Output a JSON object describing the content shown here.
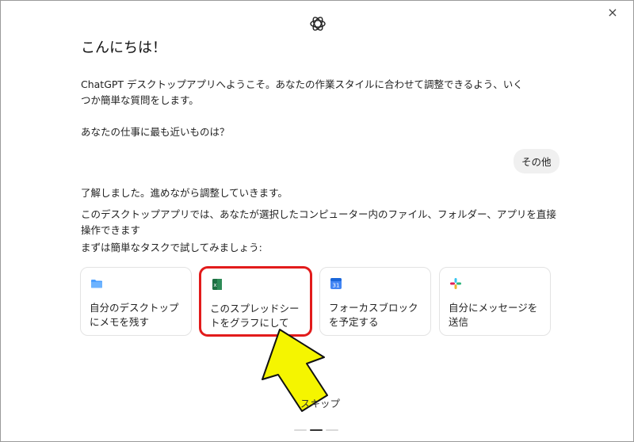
{
  "window": {
    "close_label": "×"
  },
  "greeting": "こんにちは！",
  "intro": "ChatGPT デスクトップアプリへようこそ。あなたの作業スタイルに合わせて調整できるよう、いくつか簡単な質問をします。",
  "question": "あなたの仕事に最も近いものは？",
  "user_reply": "その他",
  "ack": "了解しました。進めながら調整していきます。",
  "explain": "このデスクトップアプリでは、あなたが選択したコンピューター内のファイル、フォルダー、アプリを直接操作できます",
  "task_prompt": "まずは簡単なタスクで試してみましょう:",
  "cards": [
    {
      "label": "自分のデスクトップにメモを残す",
      "icon": "folder-icon"
    },
    {
      "label": "このスプレッドシートをグラフにして",
      "icon": "spreadsheet-icon"
    },
    {
      "label": "フォーカスブロックを予定する",
      "icon": "calendar-icon",
      "icon_text": "31"
    },
    {
      "label": "自分にメッセージを送信",
      "icon": "slack-icon"
    }
  ],
  "skip_label": "スキップ",
  "colors": {
    "highlight": "#e21b1b",
    "arrow_fill": "#f5f500",
    "folder": "#4a9eff",
    "sheet": "#1d6f42",
    "calendar": "#4285f4"
  },
  "pagination": {
    "current": 2,
    "total": 3
  }
}
